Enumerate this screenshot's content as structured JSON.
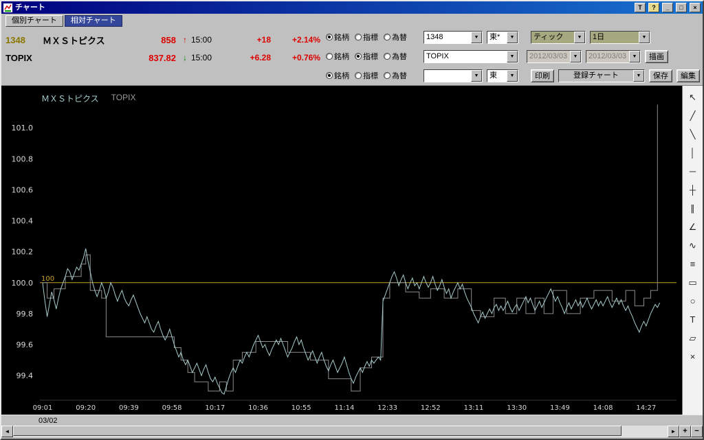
{
  "window": {
    "title": "チャート",
    "buttons": {
      "topmost": "T",
      "help": "?",
      "minimize": "_",
      "maximize": "□",
      "close": "×"
    }
  },
  "icons": {
    "dropdown": "▼",
    "scroll_left": "◄",
    "scroll_right": "►",
    "zoom_in": "+",
    "zoom_out": "−"
  },
  "tabs": [
    {
      "label": "個別チャート",
      "active": false
    },
    {
      "label": "相対チャート",
      "active": true
    }
  ],
  "quotes": [
    {
      "code": "1348",
      "name": "ＭＸＳトピクス",
      "price": "858",
      "direction": "up",
      "arrow": "↑",
      "time": "15:00",
      "change": "+18",
      "change_pct": "+2.14%"
    },
    {
      "code": "TOPIX",
      "name": "",
      "price": "837.82",
      "direction": "down",
      "arrow": "↓",
      "time": "15:00",
      "change": "+6.28",
      "change_pct": "+0.76%"
    }
  ],
  "selectors": {
    "rows": [
      {
        "radios": [
          {
            "key": "symbol",
            "label": "銘柄",
            "selected": true
          },
          {
            "key": "indicator",
            "label": "指標",
            "selected": false
          },
          {
            "key": "fx",
            "label": "為替",
            "selected": false
          }
        ],
        "code": "1348",
        "exchange": "東*"
      },
      {
        "radios": [
          {
            "key": "symbol",
            "label": "銘柄",
            "selected": false
          },
          {
            "key": "indicator",
            "label": "指標",
            "selected": true
          },
          {
            "key": "fx",
            "label": "為替",
            "selected": false
          }
        ],
        "code": "TOPIX",
        "exchange": ""
      },
      {
        "radios": [
          {
            "key": "symbol",
            "label": "銘柄",
            "selected": true
          },
          {
            "key": "indicator",
            "label": "指標",
            "selected": false
          },
          {
            "key": "fx",
            "label": "為替",
            "selected": false
          }
        ],
        "code": "",
        "exchange": "東"
      }
    ],
    "period": "ティック",
    "span": "1日",
    "date_from": "2012/03/03",
    "date_to": "2012/03/03",
    "buttons": {
      "draw": "描画",
      "print": "印刷",
      "registered_chart": "登録チャート",
      "save": "保存",
      "edit": "編集"
    }
  },
  "toolbar": {
    "icons": [
      {
        "name": "pointer-icon",
        "glyph": "↖"
      },
      {
        "name": "trend-line-icon",
        "glyph": "╱"
      },
      {
        "name": "segment-line-icon",
        "glyph": "╲"
      },
      {
        "name": "vertical-line-icon",
        "glyph": "│"
      },
      {
        "name": "horizontal-line-icon",
        "glyph": "─"
      },
      {
        "name": "cross-line-icon",
        "glyph": "┼"
      },
      {
        "name": "parallel-channel-icon",
        "glyph": "∥"
      },
      {
        "name": "angle-line-icon",
        "glyph": "∠"
      },
      {
        "name": "wave-line-icon",
        "glyph": "∿"
      },
      {
        "name": "fibonacci-icon",
        "glyph": "≡"
      },
      {
        "name": "rectangle-icon",
        "glyph": "▭"
      },
      {
        "name": "ellipse-icon",
        "glyph": "○"
      },
      {
        "name": "text-tool-icon",
        "glyph": "T"
      },
      {
        "name": "eraser-icon",
        "glyph": "▱"
      },
      {
        "name": "delete-icon",
        "glyph": "×"
      }
    ]
  },
  "bottom": {
    "date_label": "03/02"
  },
  "chart_data": {
    "type": "line",
    "title": "",
    "xlabel": "",
    "ylabel": "",
    "grid": false,
    "legend_position": "top-left",
    "x_note": "x = trading minutes from 09:01; lunch break 11:30-12:30 compressed out",
    "ylim": [
      99.25,
      101.2
    ],
    "yticks": [
      99.4,
      99.6,
      99.8,
      100.0,
      100.2,
      100.4,
      100.6,
      100.8,
      101.0
    ],
    "baseline": {
      "value": 100.0,
      "label": "100",
      "color": "#c9a227"
    },
    "xticks": [
      {
        "m": 0,
        "label": "09:01"
      },
      {
        "m": 19,
        "label": "09:20"
      },
      {
        "m": 38,
        "label": "09:39"
      },
      {
        "m": 57,
        "label": "09:58"
      },
      {
        "m": 76,
        "label": "10:17"
      },
      {
        "m": 95,
        "label": "10:36"
      },
      {
        "m": 114,
        "label": "10:55"
      },
      {
        "m": 133,
        "label": "11:14"
      },
      {
        "m": 152,
        "label": "12:33"
      },
      {
        "m": 171,
        "label": "12:52"
      },
      {
        "m": 190,
        "label": "13:11"
      },
      {
        "m": 209,
        "label": "13:30"
      },
      {
        "m": 228,
        "label": "13:49"
      },
      {
        "m": 247,
        "label": "14:08"
      },
      {
        "m": 266,
        "label": "14:27"
      }
    ],
    "legend": [
      {
        "name": "ＭＸＳトピクス",
        "color": "#a8cccc"
      },
      {
        "name": "TOPIX",
        "color": "#9a9a9a"
      }
    ],
    "series": [
      {
        "name": "ＭＸＳトピクス",
        "type": "line",
        "color": "#a8cccc",
        "x_start_min": 0,
        "values": [
          100.0,
          99.88,
          99.78,
          99.86,
          99.94,
          99.89,
          99.83,
          99.9,
          99.96,
          100.0,
          100.04,
          100.09,
          100.07,
          100.02,
          100.06,
          100.1,
          100.08,
          100.12,
          100.16,
          100.22,
          100.14,
          100.07,
          100.0,
          99.95,
          99.91,
          99.95,
          100.0,
          99.96,
          99.9,
          99.94,
          100.0,
          99.97,
          99.92,
          99.88,
          99.92,
          99.95,
          99.9,
          99.87,
          99.85,
          99.89,
          99.92,
          99.88,
          99.84,
          99.8,
          99.77,
          99.74,
          99.78,
          99.74,
          99.7,
          99.68,
          99.72,
          99.75,
          99.7,
          99.66,
          99.63,
          99.66,
          99.7,
          99.65,
          99.6,
          99.56,
          99.52,
          99.55,
          99.5,
          99.47,
          99.5,
          99.46,
          99.42,
          99.45,
          99.48,
          99.44,
          99.4,
          99.44,
          99.47,
          99.42,
          99.38,
          99.36,
          99.39,
          99.35,
          99.32,
          99.29,
          99.28,
          99.33,
          99.38,
          99.42,
          99.45,
          99.42,
          99.46,
          99.5,
          99.48,
          99.52,
          99.55,
          99.52,
          99.56,
          99.6,
          99.63,
          99.66,
          99.62,
          99.58,
          99.6,
          99.56,
          99.53,
          99.57,
          99.6,
          99.63,
          99.6,
          99.64,
          99.6,
          99.56,
          99.52,
          99.55,
          99.58,
          99.62,
          99.65,
          99.6,
          99.63,
          99.58,
          99.54,
          99.5,
          99.53,
          99.56,
          99.52,
          99.48,
          99.52,
          99.55,
          99.5,
          99.46,
          99.43,
          99.47,
          99.5,
          99.46,
          99.42,
          99.45,
          99.48,
          99.52,
          99.47,
          99.42,
          99.38,
          99.35,
          99.39,
          99.42,
          99.45,
          99.42,
          99.46,
          99.49,
          99.46,
          99.5,
          99.48,
          99.5,
          99.52,
          99.5,
          99.88,
          99.92,
          99.96,
          100.0,
          100.04,
          100.07,
          100.03,
          99.98,
          100.02,
          100.05,
          100.0,
          99.96,
          100.0,
          100.03,
          99.98,
          100.0,
          99.96,
          100.0,
          100.04,
          100.0,
          99.97,
          100.0,
          100.04,
          99.99,
          99.95,
          99.98,
          100.02,
          99.97,
          99.93,
          99.96,
          99.9,
          99.94,
          99.97,
          100.0,
          99.96,
          99.99,
          99.94,
          99.9,
          99.87,
          99.84,
          99.8,
          99.77,
          99.74,
          99.78,
          99.81,
          99.77,
          99.8,
          99.83,
          99.8,
          99.84,
          99.86,
          99.82,
          99.85,
          99.82,
          99.85,
          99.88,
          99.84,
          99.81,
          99.84,
          99.86,
          99.82,
          99.85,
          99.88,
          99.91,
          99.87,
          99.9,
          99.86,
          99.82,
          99.85,
          99.88,
          99.84,
          99.87,
          99.9,
          99.93,
          99.96,
          99.92,
          99.88,
          99.91,
          99.87,
          99.84,
          99.8,
          99.84,
          99.87,
          99.83,
          99.86,
          99.89,
          99.85,
          99.88,
          99.84,
          99.87,
          99.9,
          99.86,
          99.83,
          99.86,
          99.89,
          99.85,
          99.88,
          99.85,
          99.88,
          99.91,
          99.87,
          99.84,
          99.87,
          99.9,
          99.86,
          99.89,
          99.85,
          99.82,
          99.85,
          99.81,
          99.78,
          99.74,
          99.71,
          99.68,
          99.72,
          99.75,
          99.72,
          99.76,
          99.8,
          99.83,
          99.86,
          99.84,
          99.87
        ]
      },
      {
        "name": "TOPIX",
        "type": "step",
        "color": "#8c8c8c",
        "points": [
          [
            0,
            100.0
          ],
          [
            2,
            99.9
          ],
          [
            5,
            99.96
          ],
          [
            10,
            100.04
          ],
          [
            17,
            100.12
          ],
          [
            19,
            100.18
          ],
          [
            21,
            99.95
          ],
          [
            26,
            99.9
          ],
          [
            28,
            99.65
          ],
          [
            58,
            99.58
          ],
          [
            61,
            99.5
          ],
          [
            64,
            99.42
          ],
          [
            67,
            99.36
          ],
          [
            73,
            99.3
          ],
          [
            78,
            99.36
          ],
          [
            81,
            99.3
          ],
          [
            84,
            99.5
          ],
          [
            88,
            99.55
          ],
          [
            94,
            99.62
          ],
          [
            108,
            99.55
          ],
          [
            118,
            99.5
          ],
          [
            126,
            99.38
          ],
          [
            136,
            99.3
          ],
          [
            140,
            99.45
          ],
          [
            145,
            99.52
          ],
          [
            150,
            99.9
          ],
          [
            153,
            100.0
          ],
          [
            160,
            99.94
          ],
          [
            166,
            99.9
          ],
          [
            171,
            99.96
          ],
          [
            177,
            99.9
          ],
          [
            183,
            99.96
          ],
          [
            189,
            99.82
          ],
          [
            193,
            99.78
          ],
          [
            199,
            99.9
          ],
          [
            204,
            99.8
          ],
          [
            209,
            99.9
          ],
          [
            213,
            99.8
          ],
          [
            217,
            99.9
          ],
          [
            221,
            99.8
          ],
          [
            225,
            99.95
          ],
          [
            231,
            99.8
          ],
          [
            237,
            99.9
          ],
          [
            243,
            99.95
          ],
          [
            251,
            99.88
          ],
          [
            257,
            99.95
          ],
          [
            261,
            99.85
          ],
          [
            265,
            99.9
          ],
          [
            268,
            99.95
          ],
          [
            271,
            101.15
          ]
        ]
      }
    ]
  }
}
